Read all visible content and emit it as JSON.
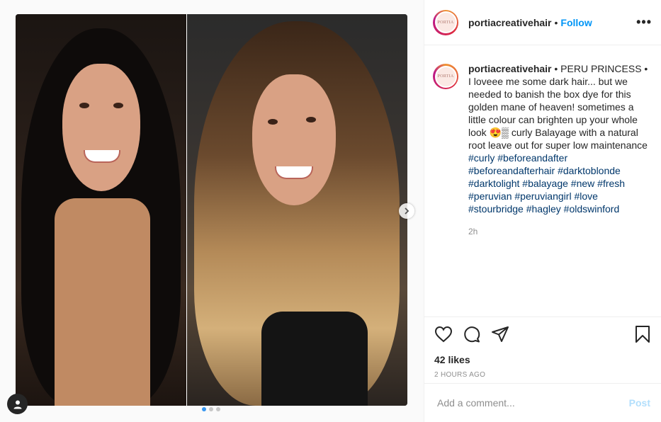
{
  "post": {
    "username": "portiacreativehair",
    "follow_label": "Follow",
    "separator": "•",
    "more_label": "•••",
    "avatar_text": "PORTIA",
    "caption": {
      "username": "portiacreativehair",
      "text": "• PERU PRINCESS • I loveee me some dark hair... but we needed to banish the box dye for this golden mane of heaven! sometimes a little colour can brighten up your whole look 😍▒ curly Balayage with a natural root leave out for super low maintenance",
      "hashtags": [
        "#curly",
        "#beforeandafter",
        "#beforeandafterhair",
        "#darktoblonde",
        "#darktolight",
        "#balayage",
        "#new",
        "#fresh",
        "#peruvian",
        "#peruviangirl",
        "#love",
        "#stourbridge",
        "#hagley",
        "#oldswinford"
      ],
      "time": "2h"
    },
    "likes": "42 likes",
    "timestamp": "2 HOURS AGO",
    "comment": {
      "placeholder": "Add a comment...",
      "post_label": "Post"
    },
    "carousel": {
      "current": 1,
      "total": 3
    }
  },
  "icons": {
    "like": "heart-icon",
    "comment": "comment-icon",
    "share": "share-icon",
    "save": "bookmark-icon",
    "next": "chevron-right-icon",
    "user_tag": "user-icon"
  },
  "colors": {
    "follow": "#0095f6",
    "hashtag": "#00376b",
    "post_disabled": "#b2dffc",
    "muted": "#8e8e8e",
    "dot_active": "#3897f0"
  }
}
